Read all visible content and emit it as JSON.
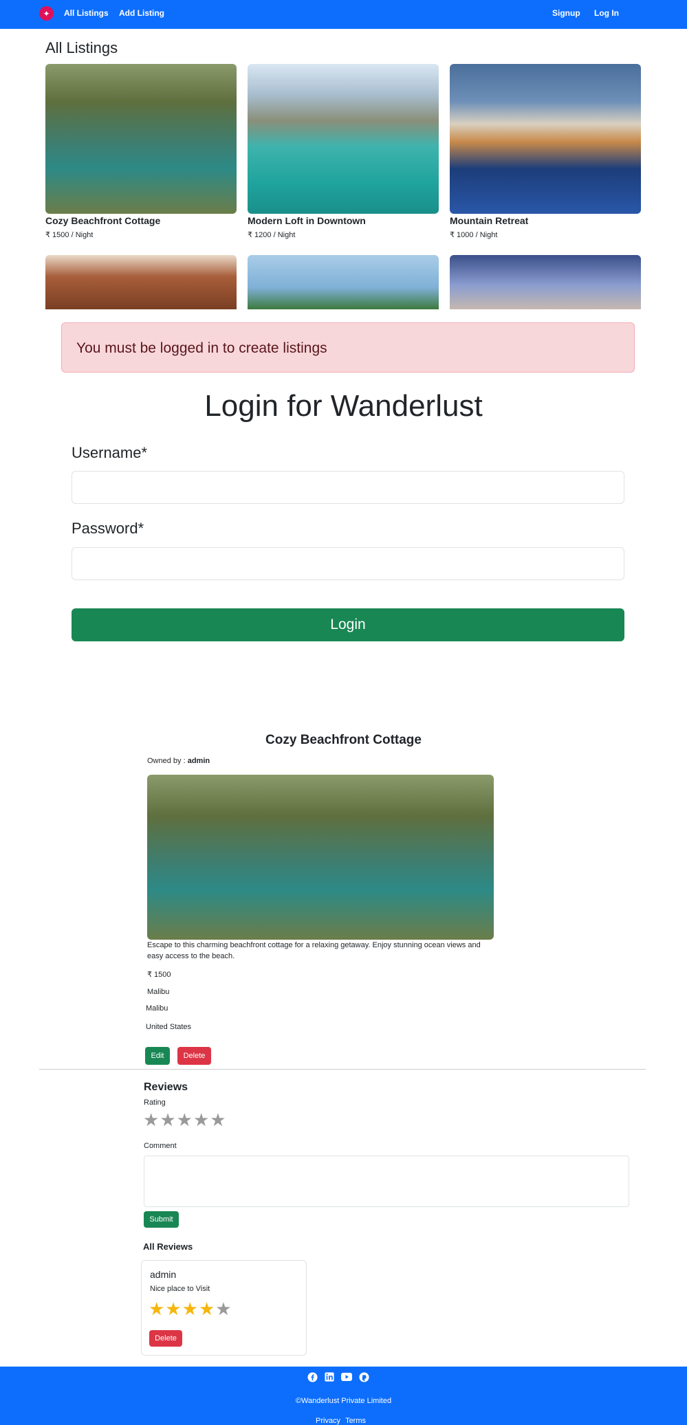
{
  "navbar": {
    "brand_icon": "compass-icon",
    "all_listings": "All Listings",
    "add_listing": "Add Listing",
    "signup": "Signup",
    "login": "Log In",
    "color": "#0d6efd"
  },
  "listings": {
    "title": "All Listings",
    "cards": [
      {
        "title": "Cozy Beachfront Cottage",
        "price": "₹ 1500 / Night"
      },
      {
        "title": "Modern Loft in Downtown",
        "price": "₹ 1200 / Night"
      },
      {
        "title": "Mountain Retreat",
        "price": "₹ 1000 / Night"
      }
    ]
  },
  "alert": {
    "message": "You must be logged in to create listings"
  },
  "login": {
    "title": "Login for Wanderlust",
    "username_label": "Username*",
    "password_label": "Password*",
    "button": "Login"
  },
  "show": {
    "title": "Cozy Beachfront Cottage",
    "owner_prefix": "Owned by : ",
    "owner": "admin",
    "description": "Escape to this charming beachfront cottage for a relaxing getaway. Enjoy stunning ocean views and easy access to the beach.",
    "price": "₹ 1500",
    "location_clipped": "Malibu",
    "location": "Malibu",
    "country": "United States",
    "edit": "Edit",
    "delete": "Delete"
  },
  "reviews": {
    "title": "Reviews",
    "rating_label": "Rating",
    "rating_value": 0,
    "comment_label": "Comment",
    "submit": "Submit",
    "all_reviews": "All Reviews",
    "items": [
      {
        "author": "admin",
        "comment": "Nice place to Visit",
        "rating": 4,
        "delete": "Delete"
      }
    ]
  },
  "footer": {
    "icons": [
      "facebook-icon",
      "linkedin-icon",
      "youtube-icon",
      "github-icon"
    ],
    "copyright": "©Wanderlust Private Limited",
    "privacy": "Privacy",
    "terms": "Terms"
  }
}
